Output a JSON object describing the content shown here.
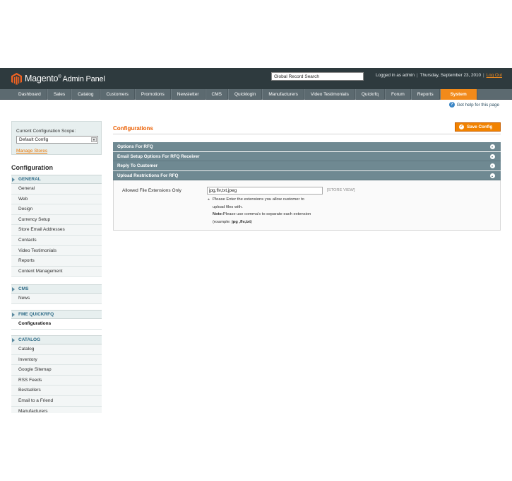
{
  "header": {
    "logo_text": "Magento",
    "logo_subtext": "Admin Panel",
    "search_value": "Global Record Search",
    "logged_in": "Logged in as admin",
    "date": "Thursday, September 23, 2010",
    "logout": "Log Out"
  },
  "nav": {
    "items": [
      "Dashboard",
      "Sales",
      "Catalog",
      "Customers",
      "Promotions",
      "Newsletter",
      "CMS",
      "Quicklogin",
      "Manufacturers",
      "Video Testimonials",
      "Quickrfq",
      "Forum",
      "Reports",
      "System"
    ],
    "active": "System",
    "help": "Get help for this page"
  },
  "sidebar": {
    "scope_label": "Current Configuration Scope:",
    "scope_value": "Default Config",
    "manage_stores": "Manage Stores",
    "title": "Configuration",
    "groups": [
      {
        "title": "GENERAL",
        "items": [
          "General",
          "Web",
          "Design",
          "Currency Setup",
          "Store Email Addresses",
          "Contacts",
          "Video Testimonials",
          "Reports",
          "Content Management"
        ]
      },
      {
        "title": "CMS",
        "items": [
          "News"
        ]
      },
      {
        "title": "FME QUICKRFQ",
        "items": [
          "Configurations"
        ]
      },
      {
        "title": "CATALOG",
        "items": [
          "Catalog",
          "Inventory",
          "Google Sitemap",
          "RSS Feeds",
          "Bestsellers",
          "Email to a Friend",
          "Manufacturers"
        ]
      }
    ],
    "active_item": "Configurations"
  },
  "main": {
    "title": "Configurations",
    "save_button": "Save Config",
    "sections": [
      {
        "label": "Options For RFQ",
        "state": "collapsed"
      },
      {
        "label": "Email Setup Options For RFQ Receiver",
        "state": "collapsed"
      },
      {
        "label": "Reply To Customer",
        "state": "collapsed"
      },
      {
        "label": "Upload Restrictions For RFQ",
        "state": "expanded"
      }
    ],
    "field": {
      "label": "Allowed File Extensions Only",
      "value": "jpg,flv,txt,jpeg",
      "scope": "[STORE VIEW]",
      "note_line1": "Please Enter the extensions you allow customer to",
      "note_line2": "upload files with.",
      "note_label": "Note:",
      "note_line3": "Please use comma's to separate each extension",
      "note_example_prefix": "(example: ",
      "note_example": "jpg ,flv,txt",
      "note_example_suffix": ")"
    }
  },
  "colors": {
    "accent": "#f18200",
    "header": "#2e3a3e",
    "nav": "#5c6a70",
    "section": "#6f8992",
    "title": "#eb5e00"
  },
  "icons": [
    "magento-logo-icon",
    "help-icon",
    "save-icon",
    "chevron-down-icon",
    "chevron-up-icon",
    "dropdown-arrow-icon"
  ]
}
